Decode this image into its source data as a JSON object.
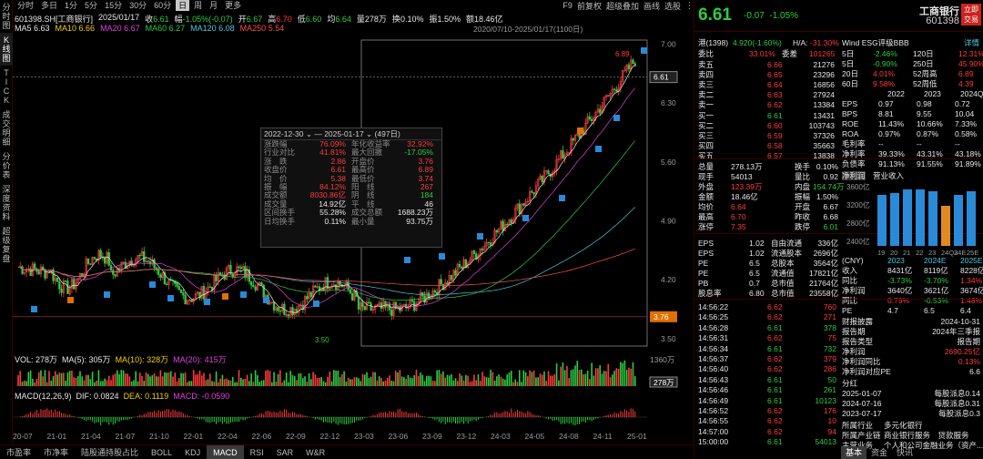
{
  "vtabs": [
    "分时图",
    "K线图",
    "TICK",
    "成交明细",
    "分价表",
    "深度资料",
    "超级复盘"
  ],
  "toolbar": [
    "分时",
    "多日",
    "1分",
    "5分",
    "15分",
    "30分",
    "60分",
    "日",
    "周",
    "月",
    "更多"
  ],
  "tool_right": [
    "F9",
    "前复权",
    "超级叠加",
    "画线",
    "选股",
    "⋮"
  ],
  "symbol": "601398.SH[工商银行]",
  "date": "2025/01/17",
  "quote": {
    "close_label": "收",
    "close": "6.61",
    "pct_label": "幅",
    "pct": "-1.05%(-0.07)",
    "open_label": "开",
    "open": "6.67",
    "high_label": "高",
    "high": "6.70",
    "low_label": "低",
    "low": "6.60",
    "avg_label": "均",
    "avg": "6.64",
    "vol_label": "量",
    "vol": "278万",
    "turn_label": "换",
    "turn": "0.10%",
    "amp_label": "振",
    "amp": "1.50%",
    "amt_label": "额",
    "amt": "18.46亿"
  },
  "ma": [
    {
      "l": "MA5",
      "v": "6.63",
      "c": "#e6e6e6"
    },
    {
      "l": "MA10",
      "v": "6.66",
      "c": "#f0d000"
    },
    {
      "l": "MA20",
      "v": "6.67",
      "c": "#e040e0"
    },
    {
      "l": "MA60",
      "v": "6.27",
      "c": "#2ecc40"
    },
    {
      "l": "MA120",
      "v": "6.08",
      "c": "#4ac6e0"
    },
    {
      "l": "MA250",
      "v": "5.54",
      "c": "#ff4d4d"
    }
  ],
  "range_label": "2020/07/10-2025/01/17(1100日)",
  "price_axis": [
    "7.00",
    "6.30",
    "5.60",
    "4.90",
    "4.20",
    "3.50"
  ],
  "last_price": "6.61",
  "mark_price": "3.76",
  "high_mark": "6.89",
  "low_mark": "3.50",
  "vol_info": {
    "vol": "VOL: 278万",
    "ma5": "MA(5): 305万",
    "ma10": "MA(10): 328万",
    "ma20": "MA(20): 415万"
  },
  "vol_axis": [
    "1360万",
    "278万"
  ],
  "macd_info": {
    "title": "MACD(12,26,9)",
    "dif": "DIF: 0.0824",
    "dea": "DEA: 0.1119",
    "macd": "MACD: -0.0590"
  },
  "xaxis": [
    "20-07",
    "21-01",
    "21-04",
    "21-07",
    "21-10",
    "22-01",
    "22-04",
    "22-06",
    "22-09",
    "22-12",
    "23-03",
    "23-06",
    "23-09",
    "23-12",
    "24-03",
    "24-05",
    "24-08",
    "24-11",
    "25-01"
  ],
  "bottom_tabs": [
    "市盈率",
    "市净率",
    "陆股通持股占比",
    "BOLL",
    "KDJ",
    "MACD",
    "RSI",
    "SAR",
    "W&R"
  ],
  "stats": {
    "from": "2022-12-30",
    "to": "2025-01-17",
    "days": "(497日)",
    "rows": [
      [
        "涨跌幅",
        "76.09%",
        "年化收益率",
        "32.92%"
      ],
      [
        "行业对比",
        "41.81%",
        "最大回撤",
        "-17.05%"
      ],
      [
        "涨　跌",
        "2.86",
        "开盘价",
        "3.76"
      ],
      [
        "收盘价",
        "6.61",
        "最高价",
        "6.89"
      ],
      [
        "均　价",
        "5.38",
        "最低价",
        "3.74"
      ],
      [
        "振　幅",
        "84.12%",
        "阳　线",
        "267"
      ],
      [
        "成交额",
        "8030.86亿",
        "阴　线",
        "184"
      ],
      [
        "成交量",
        "14.92亿",
        "平　线",
        "46"
      ],
      [
        "区间换手",
        "55.28%",
        "成交总额",
        "1688.23万"
      ],
      [
        "日均换手",
        "0.11%",
        "最小量",
        "93.75万"
      ]
    ]
  },
  "right": {
    "price": "6.61",
    "chg": "-0.07",
    "pct": "-1.05%",
    "name": "工商银行",
    "code": "601398",
    "trade": "立即交易",
    "hk": "港(1398)",
    "hk_val": "4.920(-1.60%)",
    "ah": "H/A:",
    "ah_val": "-31.30%",
    "wind": "Wind ESG评级BBB",
    "detail": "详情",
    "esg": [
      [
        "5日",
        "-2.46%",
        "120日",
        "12.31%"
      ],
      [
        "5日",
        "-0.90%",
        "250日",
        "45.90%"
      ],
      [
        "20日",
        "4.01%",
        "52周高",
        "6.89"
      ],
      [
        "60日",
        "9.58%",
        "52周低",
        "4.39"
      ]
    ],
    "bidask_hdr": [
      "委比",
      "33.01%",
      "委差",
      "101265"
    ],
    "asks": [
      [
        "卖五",
        "6.66",
        "21276"
      ],
      [
        "卖四",
        "6.65",
        "23296"
      ],
      [
        "卖三",
        "6.64",
        "16856"
      ],
      [
        "卖二",
        "6.63",
        "27924"
      ],
      [
        "卖一",
        "6.62",
        "13384"
      ]
    ],
    "bids": [
      [
        "买一",
        "6.61",
        "13431"
      ],
      [
        "买二",
        "6.60",
        "103743"
      ],
      [
        "买三",
        "6.59",
        "37326"
      ],
      [
        "买四",
        "6.58",
        "35663"
      ],
      [
        "买五",
        "6.57",
        "13838"
      ]
    ],
    "fund_hdr": [
      "",
      "2022",
      "2023",
      "2024Q3"
    ],
    "fund": [
      [
        "EPS",
        "0.97",
        "0.98",
        "0.72"
      ],
      [
        "BPS",
        "8.81",
        "9.55",
        "10.04"
      ],
      [
        "ROE",
        "11.43%",
        "10.66%",
        "7.33%"
      ],
      [
        "ROA",
        "0.97%",
        "0.87%",
        "0.58%"
      ],
      [
        "毛利率",
        "--",
        "--",
        "--"
      ],
      [
        "净利率",
        "39.33%",
        "43.31%",
        "43.18%"
      ],
      [
        "负债率",
        "91.13%",
        "91.55%",
        "91.89%"
      ]
    ],
    "stats2": [
      [
        "总量",
        "278.13万",
        "换手",
        "0.10%"
      ],
      [
        "现手",
        "54013",
        "量比",
        "0.92"
      ],
      [
        "外盘",
        "123.39万",
        "内盘",
        "154.74万"
      ],
      [
        "金额",
        "18.46亿",
        "振幅",
        "1.50%"
      ],
      [
        "均价",
        "6.64",
        "开盘",
        "6.67"
      ],
      [
        "最高",
        "6.70",
        "昨收",
        "6.68"
      ],
      [
        "涨停",
        "7.35",
        "跌停",
        "6.01"
      ]
    ],
    "profit_tabs": [
      "净利润",
      "营业收入"
    ],
    "bar_axis": [
      "3600亿",
      "3200亿",
      "2800亿",
      "2400亿"
    ],
    "bar_x": [
      "19",
      "20",
      "21",
      "22",
      "23",
      "24Q3",
      "24E",
      "25E"
    ],
    "val": [
      [
        "EPS",
        "1.02",
        "自由流通",
        "336亿"
      ],
      [
        "EPS",
        "1.02",
        "流通股本",
        "2696亿"
      ],
      [
        "PE",
        "6.5",
        "总股本",
        "3564亿"
      ],
      [
        "PE",
        "6.5",
        "流通值",
        "17821亿"
      ],
      [
        "PB",
        "0.7",
        "总市值",
        "21764亿"
      ],
      [
        "股息率",
        "6.80",
        "总市值",
        "23558亿"
      ]
    ],
    "ticks": [
      [
        "14:56:22",
        "6.62",
        "760"
      ],
      [
        "14:56:25",
        "6.62",
        "271"
      ],
      [
        "14:56:28",
        "6.61",
        "378"
      ],
      [
        "14:56:31",
        "6.62",
        "75"
      ],
      [
        "14:56:34",
        "6.61",
        "732"
      ],
      [
        "14:56:37",
        "6.62",
        "379"
      ],
      [
        "14:56:40",
        "6.62",
        "286"
      ],
      [
        "14:56:43",
        "6.61",
        "50"
      ],
      [
        "14:56:46",
        "6.61",
        "261"
      ],
      [
        "14:56:49",
        "6.61",
        "10123"
      ],
      [
        "14:56:52",
        "6.62",
        "176"
      ],
      [
        "14:56:55",
        "6.62",
        "10"
      ],
      [
        "14:57:00",
        "6.62",
        "94"
      ],
      [
        "15:00:00",
        "6.61",
        "54013"
      ]
    ],
    "proj_hdr": [
      "(CNY)",
      "2023",
      "2024E",
      "2025E"
    ],
    "proj": [
      [
        "收入",
        "8431亿",
        "8119亿",
        "8228亿"
      ],
      [
        "同比",
        "-3.73%",
        "-3.70%",
        "1.34%"
      ],
      [
        "净利润",
        "3640亿",
        "3621亿",
        "3674亿"
      ],
      [
        "同比",
        "0.79%",
        "-0.53%",
        "1.48%"
      ],
      [
        "PE",
        "4.7",
        "6.5",
        "6.4"
      ]
    ],
    "report": [
      [
        "财报披露",
        "2024-10-31"
      ],
      [
        "报告期",
        "2024年三季报"
      ],
      [
        "报告类型",
        "报告期"
      ],
      [
        "净利润",
        "2690.25亿"
      ],
      [
        "净利润同比",
        "0.13%"
      ],
      [
        "净利润对应PE",
        "6.6"
      ]
    ],
    "divs": [
      [
        "分红",
        ""
      ],
      [
        "2025-01-07",
        "每股派息0.14"
      ],
      [
        "2024-07-16",
        "每股派息0.31"
      ],
      [
        "2023-07-17",
        "每股派息0.3"
      ]
    ],
    "ind": [
      [
        "所属行业",
        "多元化银行"
      ],
      [
        "所属产业链",
        "商业银行服务　贷款服务"
      ],
      [
        "主营业务",
        "个人和公司金融业务（资产..."
      ]
    ],
    "rtabs": [
      "基本",
      "资金",
      "快讯"
    ]
  }
}
